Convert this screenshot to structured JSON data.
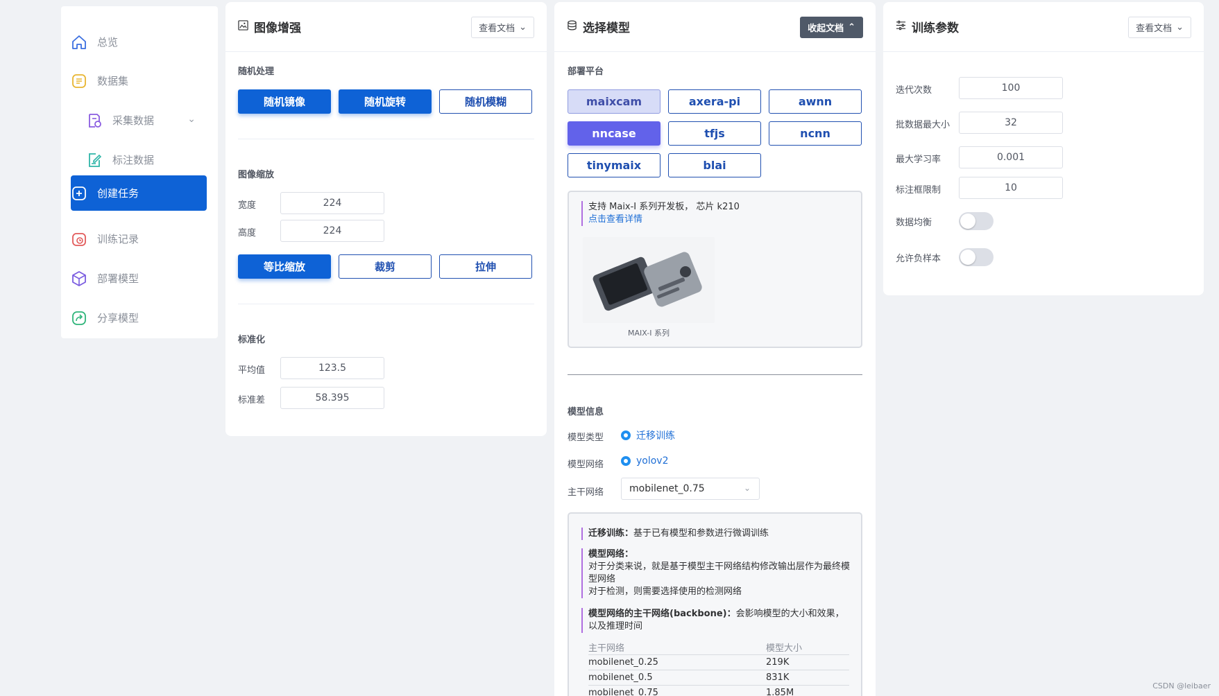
{
  "sidebar": {
    "items": [
      {
        "label": "总览",
        "icon": "home-icon"
      },
      {
        "label": "数据集",
        "icon": "dataset-icon"
      },
      {
        "label": "采集数据",
        "icon": "collect-icon"
      },
      {
        "label": "标注数据",
        "icon": "annotate-icon"
      },
      {
        "label": "创建任务",
        "icon": "plus-square-icon"
      },
      {
        "label": "训练记录",
        "icon": "training-record-icon"
      },
      {
        "label": "部署模型",
        "icon": "cube-icon"
      },
      {
        "label": "分享模型",
        "icon": "share-icon"
      }
    ],
    "active": "创建任务"
  },
  "augment": {
    "title": "图像增强",
    "doc_label": "查看文档",
    "random_title": "随机处理",
    "random_buttons": [
      "随机镜像",
      "随机旋转",
      "随机模糊"
    ],
    "resize_title": "图像缩放",
    "width_label": "宽度",
    "width_value": "224",
    "height_label": "高度",
    "height_value": "224",
    "resize_buttons": [
      "等比缩放",
      "裁剪",
      "拉伸"
    ],
    "normalize_title": "标准化",
    "mean_label": "平均值",
    "mean_value": "123.5",
    "std_label": "标准差",
    "std_value": "58.395"
  },
  "model": {
    "title": "选择模型",
    "doc_label": "收起文档",
    "platform_title": "部署平台",
    "platforms": [
      "maixcam",
      "axera-pi",
      "awnn",
      "nncase",
      "tfjs",
      "ncnn",
      "tinymaix",
      "blai"
    ],
    "selected_platform": "nncase",
    "platform_info": "支持 Maix-I 系列开发板， 芯片 k210",
    "platform_link": "点击查看详情",
    "board_caption": "MAIX-I 系列",
    "info_title": "模型信息",
    "type_label": "模型类型",
    "type_value": "迁移训练",
    "net_label": "模型网络",
    "net_value": "yolov2",
    "backbone_label": "主干网络",
    "backbone_value": "mobilenet_0.75",
    "doc1_bold": "迁移训练：",
    "doc1_text": "基于已有模型和参数进行微调训练",
    "doc2_bold": "模型网络：",
    "doc2_line1": "对于分类来说，就是基于模型主干网络结构修改输出层作为最终模型网络",
    "doc2_line2": "对于检测，则需要选择使用的检测网络",
    "doc3_bold": "模型网络的主干网络(backbone)：",
    "doc3_text": "会影响模型的大小和效果，以及推理时间",
    "table_headers": [
      "主干网络",
      "模型大小"
    ],
    "table_rows": [
      [
        "mobilenet_0.25",
        "219K"
      ],
      [
        "mobilenet_0.5",
        "831K"
      ],
      [
        "mobilenet_0.75",
        "1.85M"
      ]
    ]
  },
  "train": {
    "title": "训练参数",
    "doc_label": "查看文档",
    "epochs_label": "迭代次数",
    "epochs_value": "100",
    "batch_label": "批数据最大小",
    "batch_value": "32",
    "lr_label": "最大学习率",
    "lr_value": "0.001",
    "bbox_label": "标注框限制",
    "bbox_value": "10",
    "balance_label": "数据均衡",
    "balance_on": false,
    "negative_label": "允许负样本",
    "negative_on": false
  },
  "watermark": "CSDN @leibaer",
  "colors": {
    "primary": "#0e62d6",
    "selected_platform": "#6262ea",
    "accent_quote": "#b06ee0"
  }
}
